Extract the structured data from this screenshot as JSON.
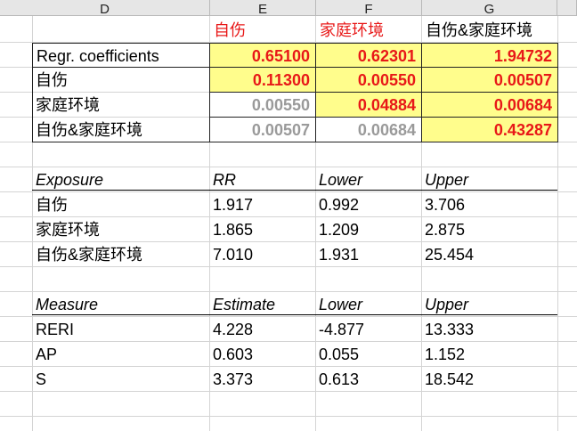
{
  "columns": [
    "D",
    "E",
    "F",
    "G"
  ],
  "coef_header": {
    "e": "自伤",
    "f": "家庭环境",
    "g": "自伤&家庭环境"
  },
  "coef_rows": [
    {
      "label": "Regr. coefficients",
      "e": "0.65100",
      "f": "0.62301",
      "g": "1.94732"
    },
    {
      "label": "自伤",
      "e": "0.11300",
      "f": "0.00550",
      "g": "0.00507"
    },
    {
      "label": "家庭环境",
      "e": "0.00550",
      "f": "0.04884",
      "g": "0.00684"
    },
    {
      "label": "自伤&家庭环境",
      "e": "0.00507",
      "f": "0.00684",
      "g": "0.43287"
    }
  ],
  "exposure_table": {
    "headers": [
      "Exposure",
      "RR",
      "Lower",
      "Upper"
    ],
    "rows": [
      [
        "自伤",
        "1.917",
        "0.992",
        "3.706"
      ],
      [
        "家庭环境",
        "1.865",
        "1.209",
        "2.875"
      ],
      [
        "自伤&家庭环境",
        "7.010",
        "1.931",
        "25.454"
      ]
    ]
  },
  "measure_table": {
    "headers": [
      "Measure",
      "Estimate",
      "Lower",
      "Upper"
    ],
    "rows": [
      [
        "RERI",
        "4.228",
        "-4.877",
        "13.333"
      ],
      [
        "AP",
        "0.603",
        "0.055",
        "1.152"
      ],
      [
        "S",
        "3.373",
        "0.613",
        "18.542"
      ]
    ]
  }
}
